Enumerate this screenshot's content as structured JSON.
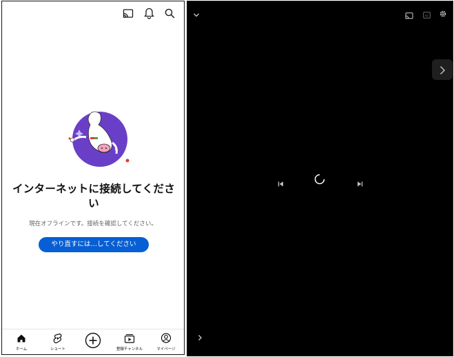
{
  "left": {
    "topbar": {
      "cast_icon": "cast-icon",
      "notification_icon": "bell-icon",
      "search_icon": "search-icon"
    },
    "offline": {
      "title_line1": "インターネットに接続してくださ",
      "title_line2": "い",
      "subtitle": "現在オフラインです。接続を確認してください。",
      "retry_label": "やり直すには…してください"
    },
    "nav": [
      {
        "label": "ホーム",
        "icon": "home-icon"
      },
      {
        "label": "ショート",
        "icon": "shorts-icon"
      },
      {
        "label": "",
        "icon": "create-plus-icon"
      },
      {
        "label": "登録チャンネル",
        "icon": "subscriptions-icon"
      },
      {
        "label": "マイページ",
        "icon": "account-icon"
      }
    ],
    "accent_color": "#065fd4",
    "illustration_color": "#6a3fc8"
  },
  "right": {
    "background": "#000000",
    "state": "loading",
    "top_left_icon": "chevron-down-icon",
    "top_right_icons": [
      "cast-icon",
      "captions-icon",
      "settings-icon"
    ],
    "side_icon": "chevron-right-icon",
    "controls": [
      "previous-icon",
      "loading-spinner",
      "next-icon"
    ],
    "bottom_left_icon": "chevron-right-icon"
  }
}
